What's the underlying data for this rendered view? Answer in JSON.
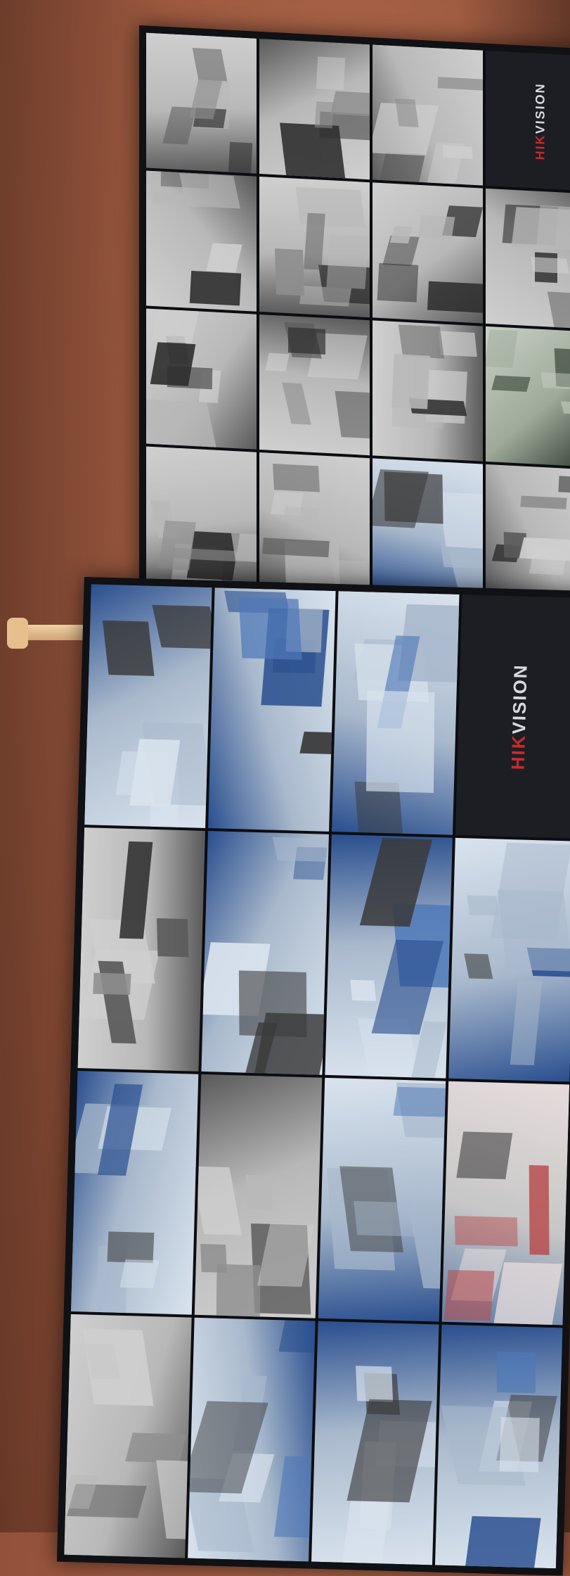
{
  "brand": {
    "logo_prefix": "HIK",
    "logo_suffix": "VISION"
  },
  "monitors": [
    {
      "id": "top",
      "tiles": [
        {
          "kind": "cam",
          "tone": "gray"
        },
        {
          "kind": "cam",
          "tone": "gray"
        },
        {
          "kind": "cam",
          "tone": "gray"
        },
        {
          "kind": "logo"
        },
        {
          "kind": "cam",
          "tone": "gray"
        },
        {
          "kind": "cam",
          "tone": "gray"
        },
        {
          "kind": "cam",
          "tone": "gray"
        },
        {
          "kind": "cam",
          "tone": "gray"
        },
        {
          "kind": "cam",
          "tone": "gray"
        },
        {
          "kind": "cam",
          "tone": "gray"
        },
        {
          "kind": "cam",
          "tone": "gray"
        },
        {
          "kind": "cam",
          "tone": "green"
        },
        {
          "kind": "cam",
          "tone": "gray"
        },
        {
          "kind": "cam",
          "tone": "gray"
        },
        {
          "kind": "cam",
          "tone": "blue"
        },
        {
          "kind": "cam",
          "tone": "gray"
        }
      ]
    },
    {
      "id": "bottom",
      "tiles": [
        {
          "kind": "cam",
          "tone": "blue"
        },
        {
          "kind": "cam",
          "tone": "blue"
        },
        {
          "kind": "cam",
          "tone": "blue"
        },
        {
          "kind": "logo"
        },
        {
          "kind": "cam",
          "tone": "gray"
        },
        {
          "kind": "cam",
          "tone": "blue"
        },
        {
          "kind": "cam",
          "tone": "blue"
        },
        {
          "kind": "cam",
          "tone": "blue"
        },
        {
          "kind": "cam",
          "tone": "blue"
        },
        {
          "kind": "cam",
          "tone": "gray"
        },
        {
          "kind": "cam",
          "tone": "blue"
        },
        {
          "kind": "cam",
          "tone": "red"
        },
        {
          "kind": "cam",
          "tone": "gray"
        },
        {
          "kind": "cam",
          "tone": "blue"
        },
        {
          "kind": "cam",
          "tone": "blue"
        },
        {
          "kind": "cam",
          "tone": "blue"
        }
      ]
    }
  ],
  "colors": {
    "wall": "#9e5a40",
    "bezel": "#101114",
    "logo_red": "#c82a2a"
  }
}
